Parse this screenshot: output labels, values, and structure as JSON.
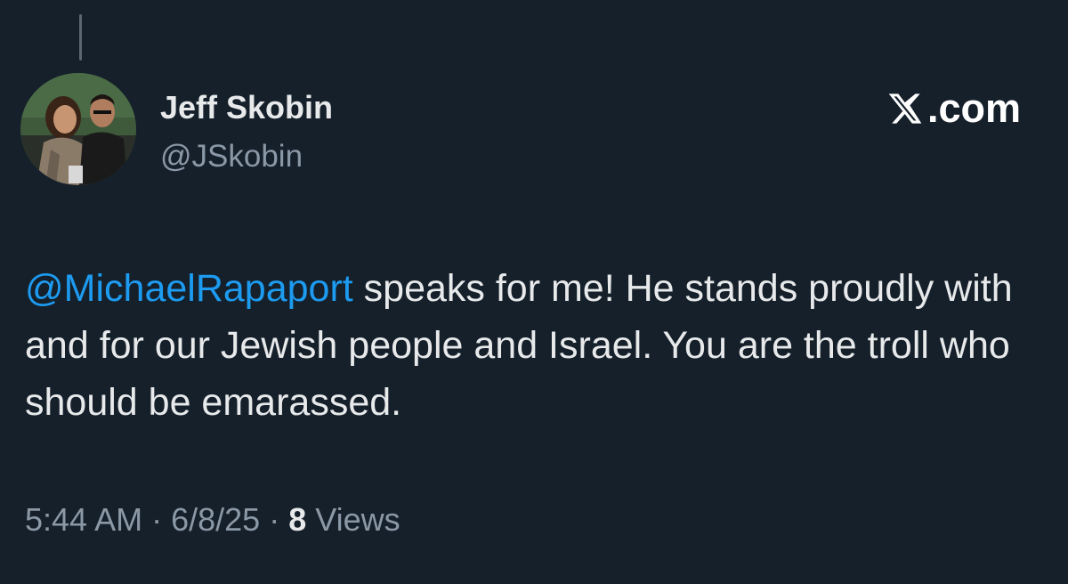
{
  "tweet": {
    "author": {
      "name": "Jeff Skobin",
      "handle": "@JSkobin"
    },
    "brand": {
      "label": ".com"
    },
    "text": {
      "mention": "@MichaelRapaport",
      "body": " speaks for me! He stands proudly with and for our Jewish people and Israel. You are the troll who should be emarassed."
    },
    "meta": {
      "time": "5:44 AM",
      "separator": " · ",
      "date": "6/8/25",
      "views_count": "8",
      "views_label": "Views"
    }
  },
  "colors": {
    "background": "#15202b",
    "text_primary": "#e7e9ea",
    "text_secondary": "#8b98a5",
    "link": "#1d9bf0"
  }
}
